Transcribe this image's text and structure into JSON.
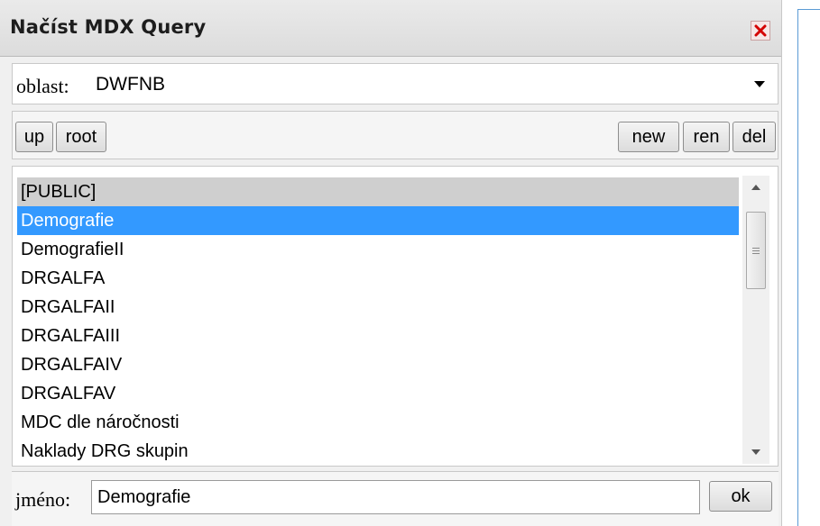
{
  "dialog": {
    "title": "Načíst MDX Query",
    "close_icon": "close-x-icon"
  },
  "area": {
    "label": "oblast:",
    "selected": "DWFNB"
  },
  "toolbar": {
    "up_label": "up",
    "root_label": "root",
    "new_label": "new",
    "ren_label": "ren",
    "del_label": "del"
  },
  "list": {
    "items": [
      {
        "label": "[PUBLIC]",
        "state": "disabled"
      },
      {
        "label": "Demografie",
        "state": "selected"
      },
      {
        "label": "DemografieII",
        "state": "normal"
      },
      {
        "label": "DRGALFA",
        "state": "normal"
      },
      {
        "label": "DRGALFAII",
        "state": "normal"
      },
      {
        "label": "DRGALFAIII",
        "state": "normal"
      },
      {
        "label": "DRGALFAIV",
        "state": "normal"
      },
      {
        "label": "DRGALFAV",
        "state": "normal"
      },
      {
        "label": "MDC dle náročnosti",
        "state": "normal"
      },
      {
        "label": "Naklady DRG skupin",
        "state": "normal"
      }
    ]
  },
  "name": {
    "label": "jméno:",
    "value": "Demografie"
  },
  "ok_label": "ok",
  "colors": {
    "selection": "#3399ff",
    "disabled_row": "#cfcfcf",
    "close_red": "#d40000"
  }
}
